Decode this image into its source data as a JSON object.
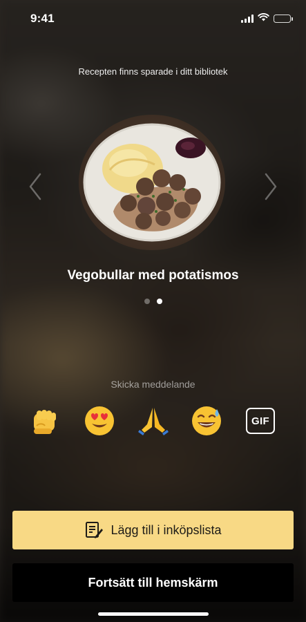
{
  "status_bar": {
    "time": "9:41",
    "icons": [
      "cellular-signal-icon",
      "wifi-icon",
      "battery-icon"
    ]
  },
  "saved_notice": "Recepten finns sparade i ditt bibliotek",
  "carousel": {
    "prev_icon": "chevron-left-icon",
    "next_icon": "chevron-right-icon",
    "recipe_title": "Vegobullar med potatismos",
    "page_count": 2,
    "active_page": 2
  },
  "reactions": {
    "label": "Skicka meddelande",
    "items": [
      {
        "name": "fist-bump-emoji",
        "glyph": "👊"
      },
      {
        "name": "heart-eyes-emoji",
        "glyph": "😍"
      },
      {
        "name": "folded-hands-emoji",
        "glyph": "🙏"
      },
      {
        "name": "sweat-smile-emoji",
        "glyph": "😅"
      }
    ],
    "gif_label": "GIF"
  },
  "buttons": {
    "add_to_list": "Lägg till i inköpslista",
    "add_to_list_icon": "shopping-list-icon",
    "continue_home": "Fortsätt till hemskärm"
  },
  "colors": {
    "primary_button": "#f8d985",
    "secondary_button": "#000000"
  }
}
